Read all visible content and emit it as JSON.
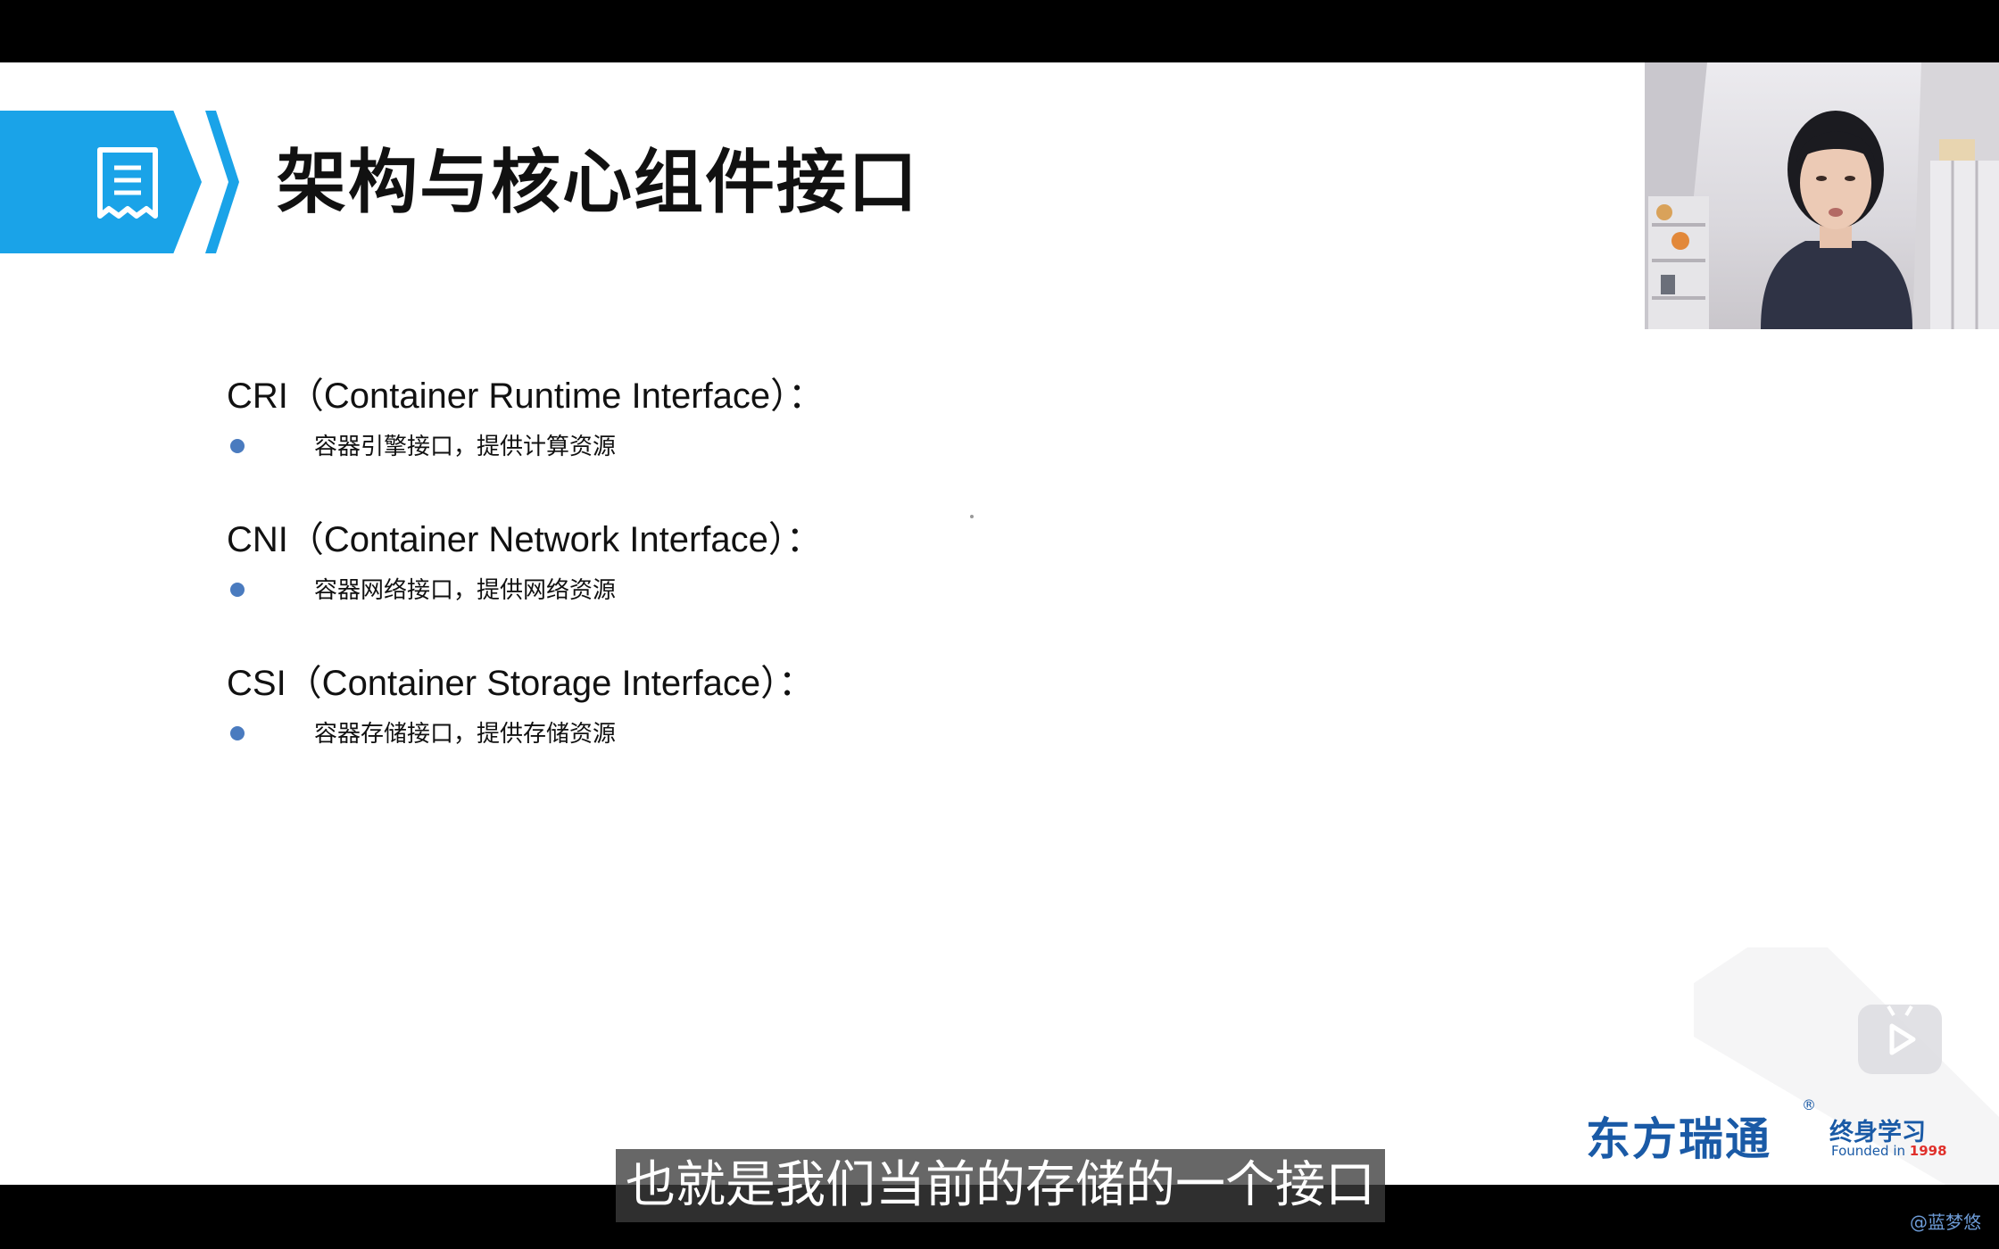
{
  "slide": {
    "title": "架构与核心组件接口",
    "sections": [
      {
        "heading": "CRI（Container Runtime Interface）：",
        "bullet": "容器引擎接口，提供计算资源"
      },
      {
        "heading": "CNI（Container Network Interface）：",
        "bullet": "容器网络接口，提供网络资源"
      },
      {
        "heading": "CSI（Container Storage Interface）：",
        "bullet": "容器存储接口，提供存储资源"
      }
    ]
  },
  "logo": {
    "brand": "东方瑞通",
    "registered": "®",
    "sub_brand": "终身学习",
    "founded": "Founded in",
    "year": "1998"
  },
  "caption": {
    "text": "也就是我们当前的存储的一个接口"
  },
  "watermark": "@蓝梦悠",
  "colors": {
    "banner": "#1aa3e8",
    "bullet": "#4a7bbf",
    "brand": "#1a5aa6",
    "year": "#e0302b"
  },
  "icons": {
    "banner": "document-list-icon",
    "player": "play-icon"
  }
}
